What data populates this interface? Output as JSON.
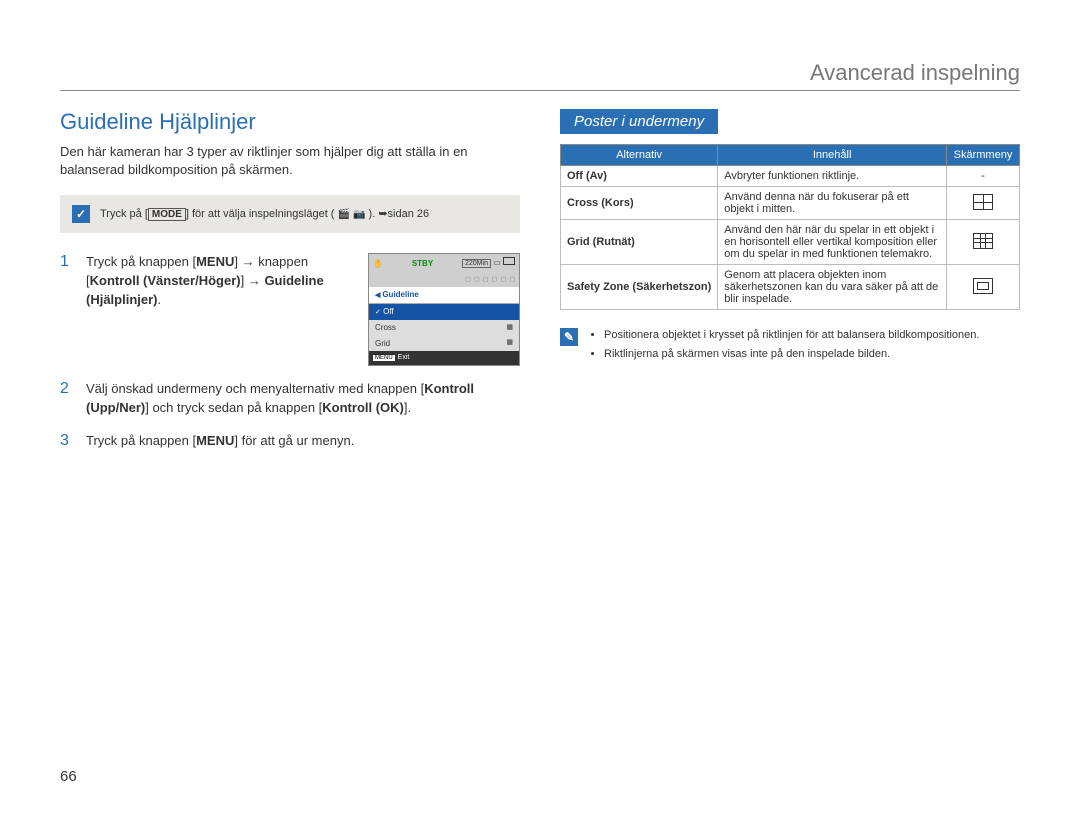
{
  "chapter": "Avancerad inspelning",
  "section_title": "Guideline Hjälplinjer",
  "intro": "Den här kameran har 3 typer av riktlinjer som hjälper dig att ställa in en balanserad bildkomposition på skärmen.",
  "mode_note": {
    "prefix": "Tryck på [",
    "mode_label": "MODE",
    "mid": "] för att välja inspelningsläget ( ",
    "suffix": " ). ➥sidan 26"
  },
  "steps": [
    {
      "num": "1",
      "text_parts": [
        "Tryck på knappen [",
        "MENU",
        "] → knappen [",
        "Kontroll (Vänster/Höger)",
        "] → ",
        "Guideline (Hjälplinjer)",
        "."
      ]
    },
    {
      "num": "2",
      "text_parts": [
        "Välj önskad undermeny och menyalternativ med knappen [",
        "Kontroll (Upp/Ner)",
        "] och tryck sedan på knappen [",
        "Kontroll (OK)",
        "]."
      ]
    },
    {
      "num": "3",
      "text_parts": [
        "Tryck på knappen [",
        "MENU",
        "] för att gå ur menyn."
      ]
    }
  ],
  "screen": {
    "stby": "STBY",
    "time": "220Min",
    "tab": "Guideline",
    "items": [
      "Off",
      "Cross",
      "Grid"
    ],
    "exit": "Exit",
    "menu_btn": "MENU"
  },
  "submenu_header": "Poster i undermeny",
  "table": {
    "headers": [
      "Alternativ",
      "Innehåll",
      "Skärmmeny"
    ],
    "rows": [
      {
        "alt": "Off (Av)",
        "desc": "Avbryter funktionen riktlinje.",
        "icon": "-"
      },
      {
        "alt": "Cross (Kors)",
        "desc": "Använd denna när du fokuserar på ett objekt i mitten.",
        "icon": "cross"
      },
      {
        "alt": "Grid (Rutnät)",
        "desc": "Använd den här när du spelar in ett objekt i en horisontell eller vertikal komposition eller om du spelar in med funktionen telemakro.",
        "icon": "grid"
      },
      {
        "alt": "Safety Zone (Säkerhetszon)",
        "desc": "Genom att placera objekten inom säkerhetszonen kan du vara säker på att de blir inspelade.",
        "icon": "safety"
      }
    ]
  },
  "tips": [
    "Positionera objektet i krysset på riktlinjen för att balansera bildkompositionen.",
    "Riktlinjerna på skärmen visas inte på den inspelade bilden."
  ],
  "page_number": "66"
}
